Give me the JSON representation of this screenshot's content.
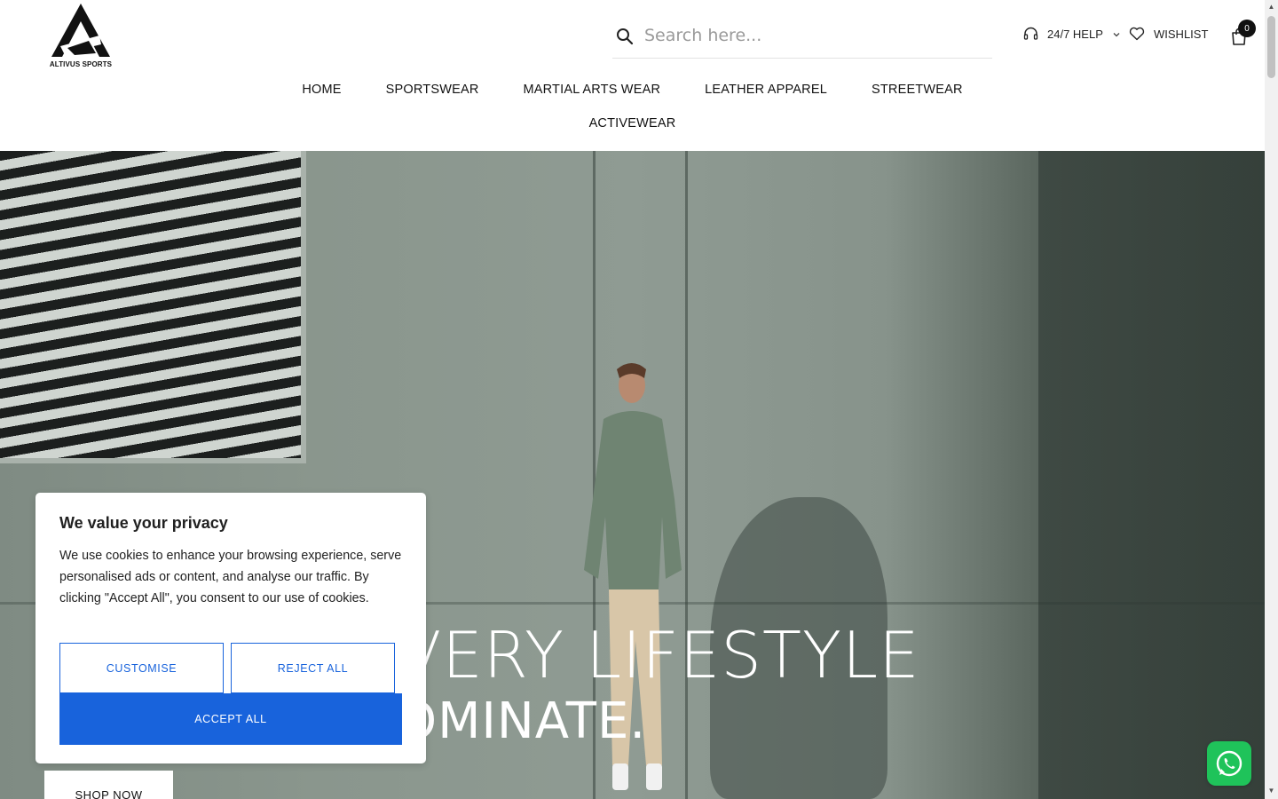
{
  "brand": {
    "logo_text": "ALTIVUS SPORTS"
  },
  "search": {
    "placeholder": "Search here..."
  },
  "header_links": {
    "help": "24/7 HELP",
    "wishlist": "WISHLIST",
    "cart_count": "0"
  },
  "nav": {
    "items": [
      "HOME",
      "SPORTSWEAR",
      "MARTIAL ARTS WEAR",
      "LEATHER APPAREL",
      "STREETWEAR"
    ],
    "second_row": [
      "ACTIVEWEAR"
    ]
  },
  "hero": {
    "title_visible": "VERY LIFESTYLE",
    "subtitle_visible": "OMINATE.",
    "cta": "SHOP NOW"
  },
  "cookie": {
    "title": "We value your privacy",
    "body": "We use cookies to enhance your browsing experience, serve personalised ads or content, and analyse our traffic. By clicking \"Accept All\", you consent to our use of cookies.",
    "customise": "CUSTOMISE",
    "reject": "REJECT ALL",
    "accept": "ACCEPT ALL"
  },
  "colors": {
    "accent": "#1863dc",
    "whatsapp": "#1fc35a"
  }
}
